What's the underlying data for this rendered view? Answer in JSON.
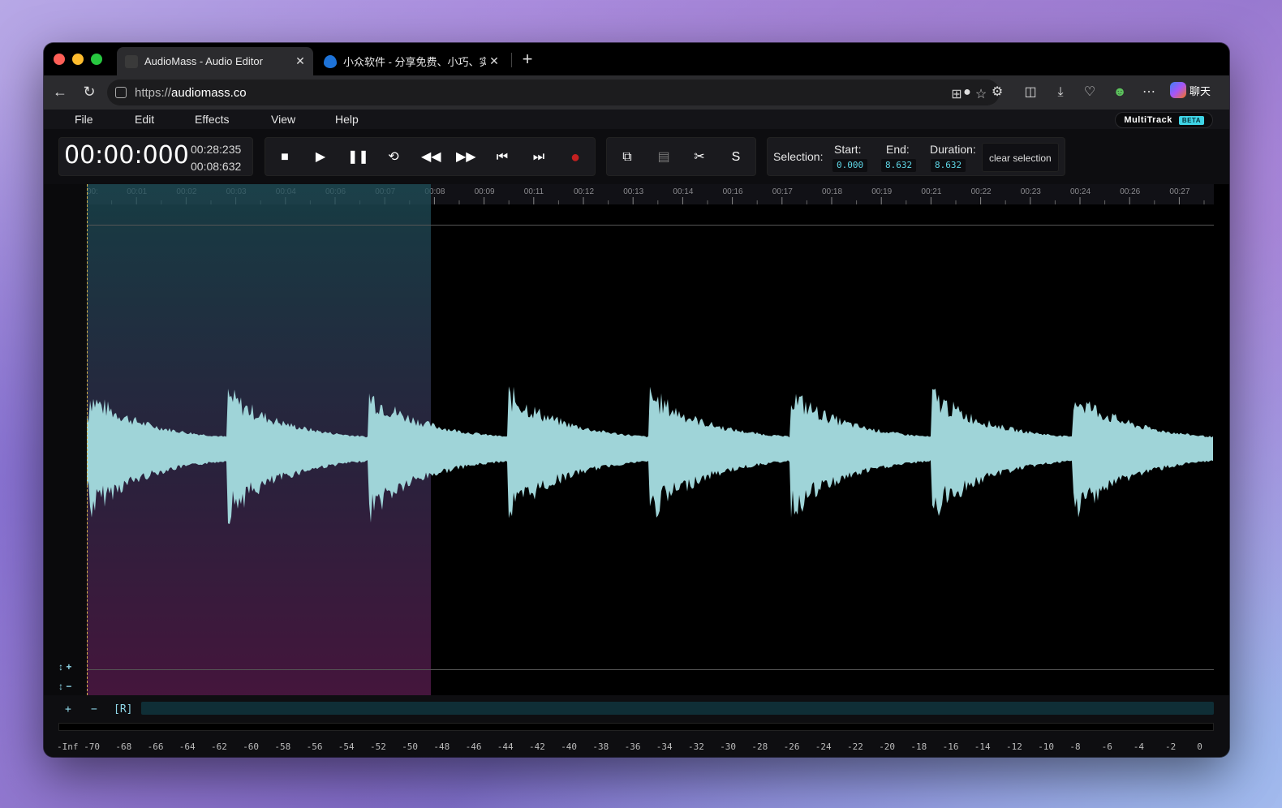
{
  "browser": {
    "tabs": [
      {
        "title": "AudioMass - Audio Editor",
        "active": true
      },
      {
        "title": "小众软件 - 分享免费、小巧、实用",
        "active": false
      }
    ],
    "url": {
      "scheme": "https://",
      "host": "audiomass.co"
    },
    "chat_label": "聊天"
  },
  "app": {
    "menu": [
      "File",
      "Edit",
      "Effects",
      "View",
      "Help"
    ],
    "multitrack_label": "MultiTrack",
    "beta_label": "BETA",
    "time": {
      "current": "00:00:000",
      "total": "00:28:235",
      "selection": "00:08:632"
    },
    "tool_s_label": "S",
    "selection": {
      "label": "Selection:",
      "start_label": "Start:",
      "start": "0.000",
      "end_label": "End:",
      "end": "8.632",
      "duration_label": "Duration:",
      "duration": "8.632",
      "clear_label": "clear selection"
    },
    "timeline_ticks": [
      "00:",
      "00:01",
      "00:02",
      "00:03",
      "00:04",
      "00:06",
      "00:07",
      "00:08",
      "00:09",
      "00:11",
      "00:12",
      "00:13",
      "00:14",
      "00:16",
      "00:17",
      "00:18",
      "00:19",
      "00:21",
      "00:22",
      "00:23",
      "00:24",
      "00:26",
      "00:27"
    ],
    "bottom": {
      "plus": "+",
      "minus": "−",
      "r_label": "[R]"
    },
    "db_scale": [
      "-Inf",
      "-70",
      "-68",
      "-66",
      "-64",
      "-62",
      "-60",
      "-58",
      "-56",
      "-54",
      "-52",
      "-50",
      "-48",
      "-46",
      "-44",
      "-42",
      "-40",
      "-38",
      "-36",
      "-34",
      "-32",
      "-30",
      "-28",
      "-26",
      "-24",
      "-22",
      "-20",
      "-18",
      "-16",
      "-14",
      "-12",
      "-10",
      "-8",
      "-6",
      "-4",
      "-2",
      "0"
    ],
    "colors": {
      "waveform": "#9fd4d8",
      "waveform_selected": "#bfe4e6",
      "selection_value": "#5fd6e6",
      "record": "#c42020"
    },
    "icons": [
      "stop-icon",
      "play-icon",
      "pause-icon",
      "loop-icon",
      "rewind-icon",
      "fast-forward-icon",
      "skip-start-icon",
      "skip-end-icon",
      "record-icon",
      "copy-icon",
      "paste-icon",
      "cut-icon"
    ]
  }
}
